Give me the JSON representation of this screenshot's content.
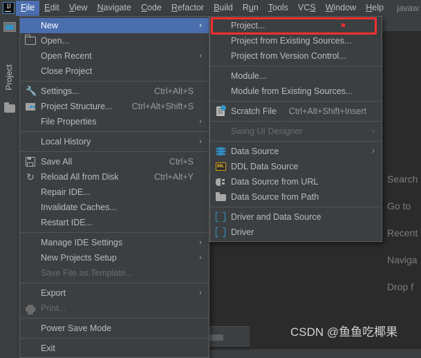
{
  "app": {
    "logo_text": "IJ",
    "context_label": "javaw"
  },
  "menubar": {
    "items": [
      {
        "label": "File",
        "mnemonic": "F",
        "active": true
      },
      {
        "label": "Edit",
        "mnemonic": "E",
        "active": false
      },
      {
        "label": "View",
        "mnemonic": "V",
        "active": false
      },
      {
        "label": "Navigate",
        "mnemonic": "N",
        "active": false
      },
      {
        "label": "Code",
        "mnemonic": "C",
        "active": false
      },
      {
        "label": "Refactor",
        "mnemonic": "R",
        "active": false
      },
      {
        "label": "Build",
        "mnemonic": "B",
        "active": false
      },
      {
        "label": "Run",
        "mnemonic": "u",
        "active": false
      },
      {
        "label": "Tools",
        "mnemonic": "T",
        "active": false
      },
      {
        "label": "VCS",
        "mnemonic": "S",
        "active": false
      },
      {
        "label": "Window",
        "mnemonic": "W",
        "active": false
      },
      {
        "label": "Help",
        "mnemonic": "H",
        "active": false
      }
    ]
  },
  "left_stripe": {
    "project_tab_label": "Project"
  },
  "file_menu": {
    "items": [
      {
        "label": "New",
        "shortcut": "",
        "icon": "none",
        "arrow": true,
        "selected": true,
        "disabled": false
      },
      {
        "label": "Open...",
        "shortcut": "",
        "icon": "folder-open",
        "arrow": false,
        "selected": false,
        "disabled": false
      },
      {
        "label": "Open Recent",
        "shortcut": "",
        "icon": "none",
        "arrow": true,
        "selected": false,
        "disabled": false
      },
      {
        "label": "Close Project",
        "shortcut": "",
        "icon": "none",
        "arrow": false,
        "selected": false,
        "disabled": false
      },
      {
        "separator": true
      },
      {
        "label": "Settings...",
        "shortcut": "Ctrl+Alt+S",
        "icon": "wrench",
        "arrow": false,
        "selected": false,
        "disabled": false
      },
      {
        "label": "Project Structure...",
        "shortcut": "Ctrl+Alt+Shift+S",
        "icon": "modules",
        "arrow": false,
        "selected": false,
        "disabled": false
      },
      {
        "label": "File Properties",
        "shortcut": "",
        "icon": "none",
        "arrow": true,
        "selected": false,
        "disabled": false
      },
      {
        "separator": true
      },
      {
        "label": "Local History",
        "shortcut": "",
        "icon": "none",
        "arrow": true,
        "selected": false,
        "disabled": false
      },
      {
        "separator": true
      },
      {
        "label": "Save All",
        "shortcut": "Ctrl+S",
        "icon": "save",
        "arrow": false,
        "selected": false,
        "disabled": false
      },
      {
        "label": "Reload All from Disk",
        "shortcut": "Ctrl+Alt+Y",
        "icon": "reload",
        "arrow": false,
        "selected": false,
        "disabled": false
      },
      {
        "label": "Repair IDE...",
        "shortcut": "",
        "icon": "none",
        "arrow": false,
        "selected": false,
        "disabled": false
      },
      {
        "label": "Invalidate Caches...",
        "shortcut": "",
        "icon": "none",
        "arrow": false,
        "selected": false,
        "disabled": false
      },
      {
        "label": "Restart IDE...",
        "shortcut": "",
        "icon": "none",
        "arrow": false,
        "selected": false,
        "disabled": false
      },
      {
        "separator": true
      },
      {
        "label": "Manage IDE Settings",
        "shortcut": "",
        "icon": "none",
        "arrow": true,
        "selected": false,
        "disabled": false
      },
      {
        "label": "New Projects Setup",
        "shortcut": "",
        "icon": "none",
        "arrow": true,
        "selected": false,
        "disabled": false
      },
      {
        "label": "Save File as Template...",
        "shortcut": "",
        "icon": "none",
        "arrow": false,
        "selected": false,
        "disabled": true
      },
      {
        "separator": true
      },
      {
        "label": "Export",
        "shortcut": "",
        "icon": "none",
        "arrow": true,
        "selected": false,
        "disabled": false
      },
      {
        "label": "Print...",
        "shortcut": "",
        "icon": "print",
        "arrow": false,
        "selected": false,
        "disabled": true
      },
      {
        "separator": true
      },
      {
        "label": "Power Save Mode",
        "shortcut": "",
        "icon": "none",
        "arrow": false,
        "selected": false,
        "disabled": false
      },
      {
        "separator": true
      },
      {
        "label": "Exit",
        "shortcut": "",
        "icon": "none",
        "arrow": false,
        "selected": false,
        "disabled": false
      }
    ]
  },
  "new_submenu": {
    "items": [
      {
        "label": "Project...",
        "shortcut": "",
        "icon": "none",
        "arrow": false,
        "disabled": false,
        "highlighted": true
      },
      {
        "label": "Project from Existing Sources...",
        "shortcut": "",
        "icon": "none",
        "arrow": false,
        "disabled": false,
        "highlighted": false
      },
      {
        "label": "Project from Version Control...",
        "shortcut": "",
        "icon": "none",
        "arrow": false,
        "disabled": false,
        "highlighted": false
      },
      {
        "separator": true
      },
      {
        "label": "Module...",
        "shortcut": "",
        "icon": "none",
        "arrow": false,
        "disabled": false,
        "highlighted": false
      },
      {
        "label": "Module from Existing Sources...",
        "shortcut": "",
        "icon": "none",
        "arrow": false,
        "disabled": false,
        "highlighted": false
      },
      {
        "separator": true
      },
      {
        "label": "Scratch File",
        "shortcut": "Ctrl+Alt+Shift+Insert",
        "icon": "scratch",
        "arrow": false,
        "disabled": false,
        "highlighted": false
      },
      {
        "separator": true
      },
      {
        "label": "Swing UI Designer",
        "shortcut": "",
        "icon": "none",
        "arrow": true,
        "disabled": true,
        "highlighted": false
      },
      {
        "separator": true
      },
      {
        "label": "Data Source",
        "shortcut": "",
        "icon": "db",
        "arrow": true,
        "disabled": false,
        "highlighted": false
      },
      {
        "label": "DDL Data Source",
        "shortcut": "",
        "icon": "ddl",
        "arrow": false,
        "disabled": false,
        "highlighted": false
      },
      {
        "label": "Data Source from URL",
        "shortcut": "",
        "icon": "url",
        "arrow": false,
        "disabled": false,
        "highlighted": false
      },
      {
        "label": "Data Source from Path",
        "shortcut": "",
        "icon": "folder",
        "arrow": false,
        "disabled": false,
        "highlighted": false
      },
      {
        "separator": true
      },
      {
        "label": "Driver and Data Source",
        "shortcut": "",
        "icon": "driver",
        "arrow": false,
        "disabled": false,
        "highlighted": false
      },
      {
        "label": "Driver",
        "shortcut": "",
        "icon": "driver",
        "arrow": false,
        "disabled": false,
        "highlighted": false
      }
    ]
  },
  "editor_hints": [
    "Search",
    "Go to",
    "Recent",
    "Naviga",
    "Drop f"
  ],
  "annotation": {
    "color": "#f03030",
    "target_label": "Project..."
  },
  "watermark": {
    "text": "CSDN @鱼鱼吃椰果"
  },
  "theme": {
    "background": "#3c3f41",
    "editor_background": "#2b2b2b",
    "selection": "#4b6eaf",
    "text": "#bbbbbb",
    "accent_blue": "#3592c4"
  }
}
